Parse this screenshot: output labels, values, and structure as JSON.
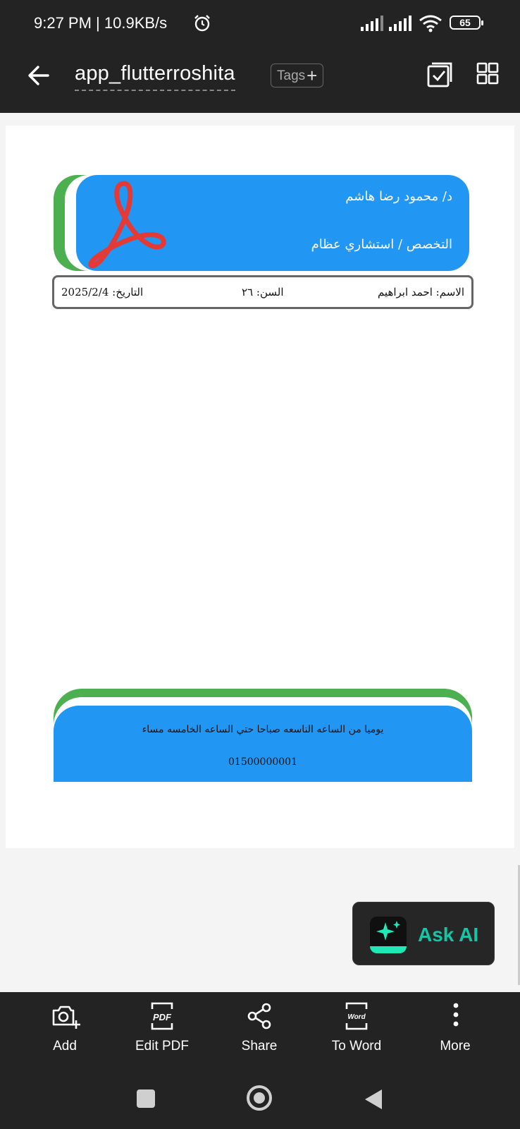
{
  "status_bar": {
    "time_speed": "9:27 PM | 10.9KB/s",
    "battery": "65"
  },
  "header": {
    "title": "app_flutterroshita",
    "tags_label": "Tags"
  },
  "document": {
    "doctor_name": "د/ محمود رضا هاشم",
    "specialty": "التخصص / استشاري عظام",
    "patient_name": "الاسم: احمد ابراهيم",
    "patient_age": "السن: ٢٦",
    "date": "التاريخ: 2025/2/4",
    "hours": "يوميا من الساعه التاسعه صباحا حتي الساعه الخامسه مساء",
    "phone": "01500000001"
  },
  "ask_ai": {
    "label": "Ask AI"
  },
  "toolbar": {
    "add": "Add",
    "edit_pdf": "Edit PDF",
    "share": "Share",
    "to_word": "To Word",
    "more": "More"
  },
  "icons": {
    "pdf_glyph": "PDF",
    "word_glyph": "Word"
  },
  "colors": {
    "card_blue": "#2196f3",
    "card_green": "#4caf50",
    "ai_accent": "#14c6a6",
    "pdf_red": "#e53935"
  }
}
